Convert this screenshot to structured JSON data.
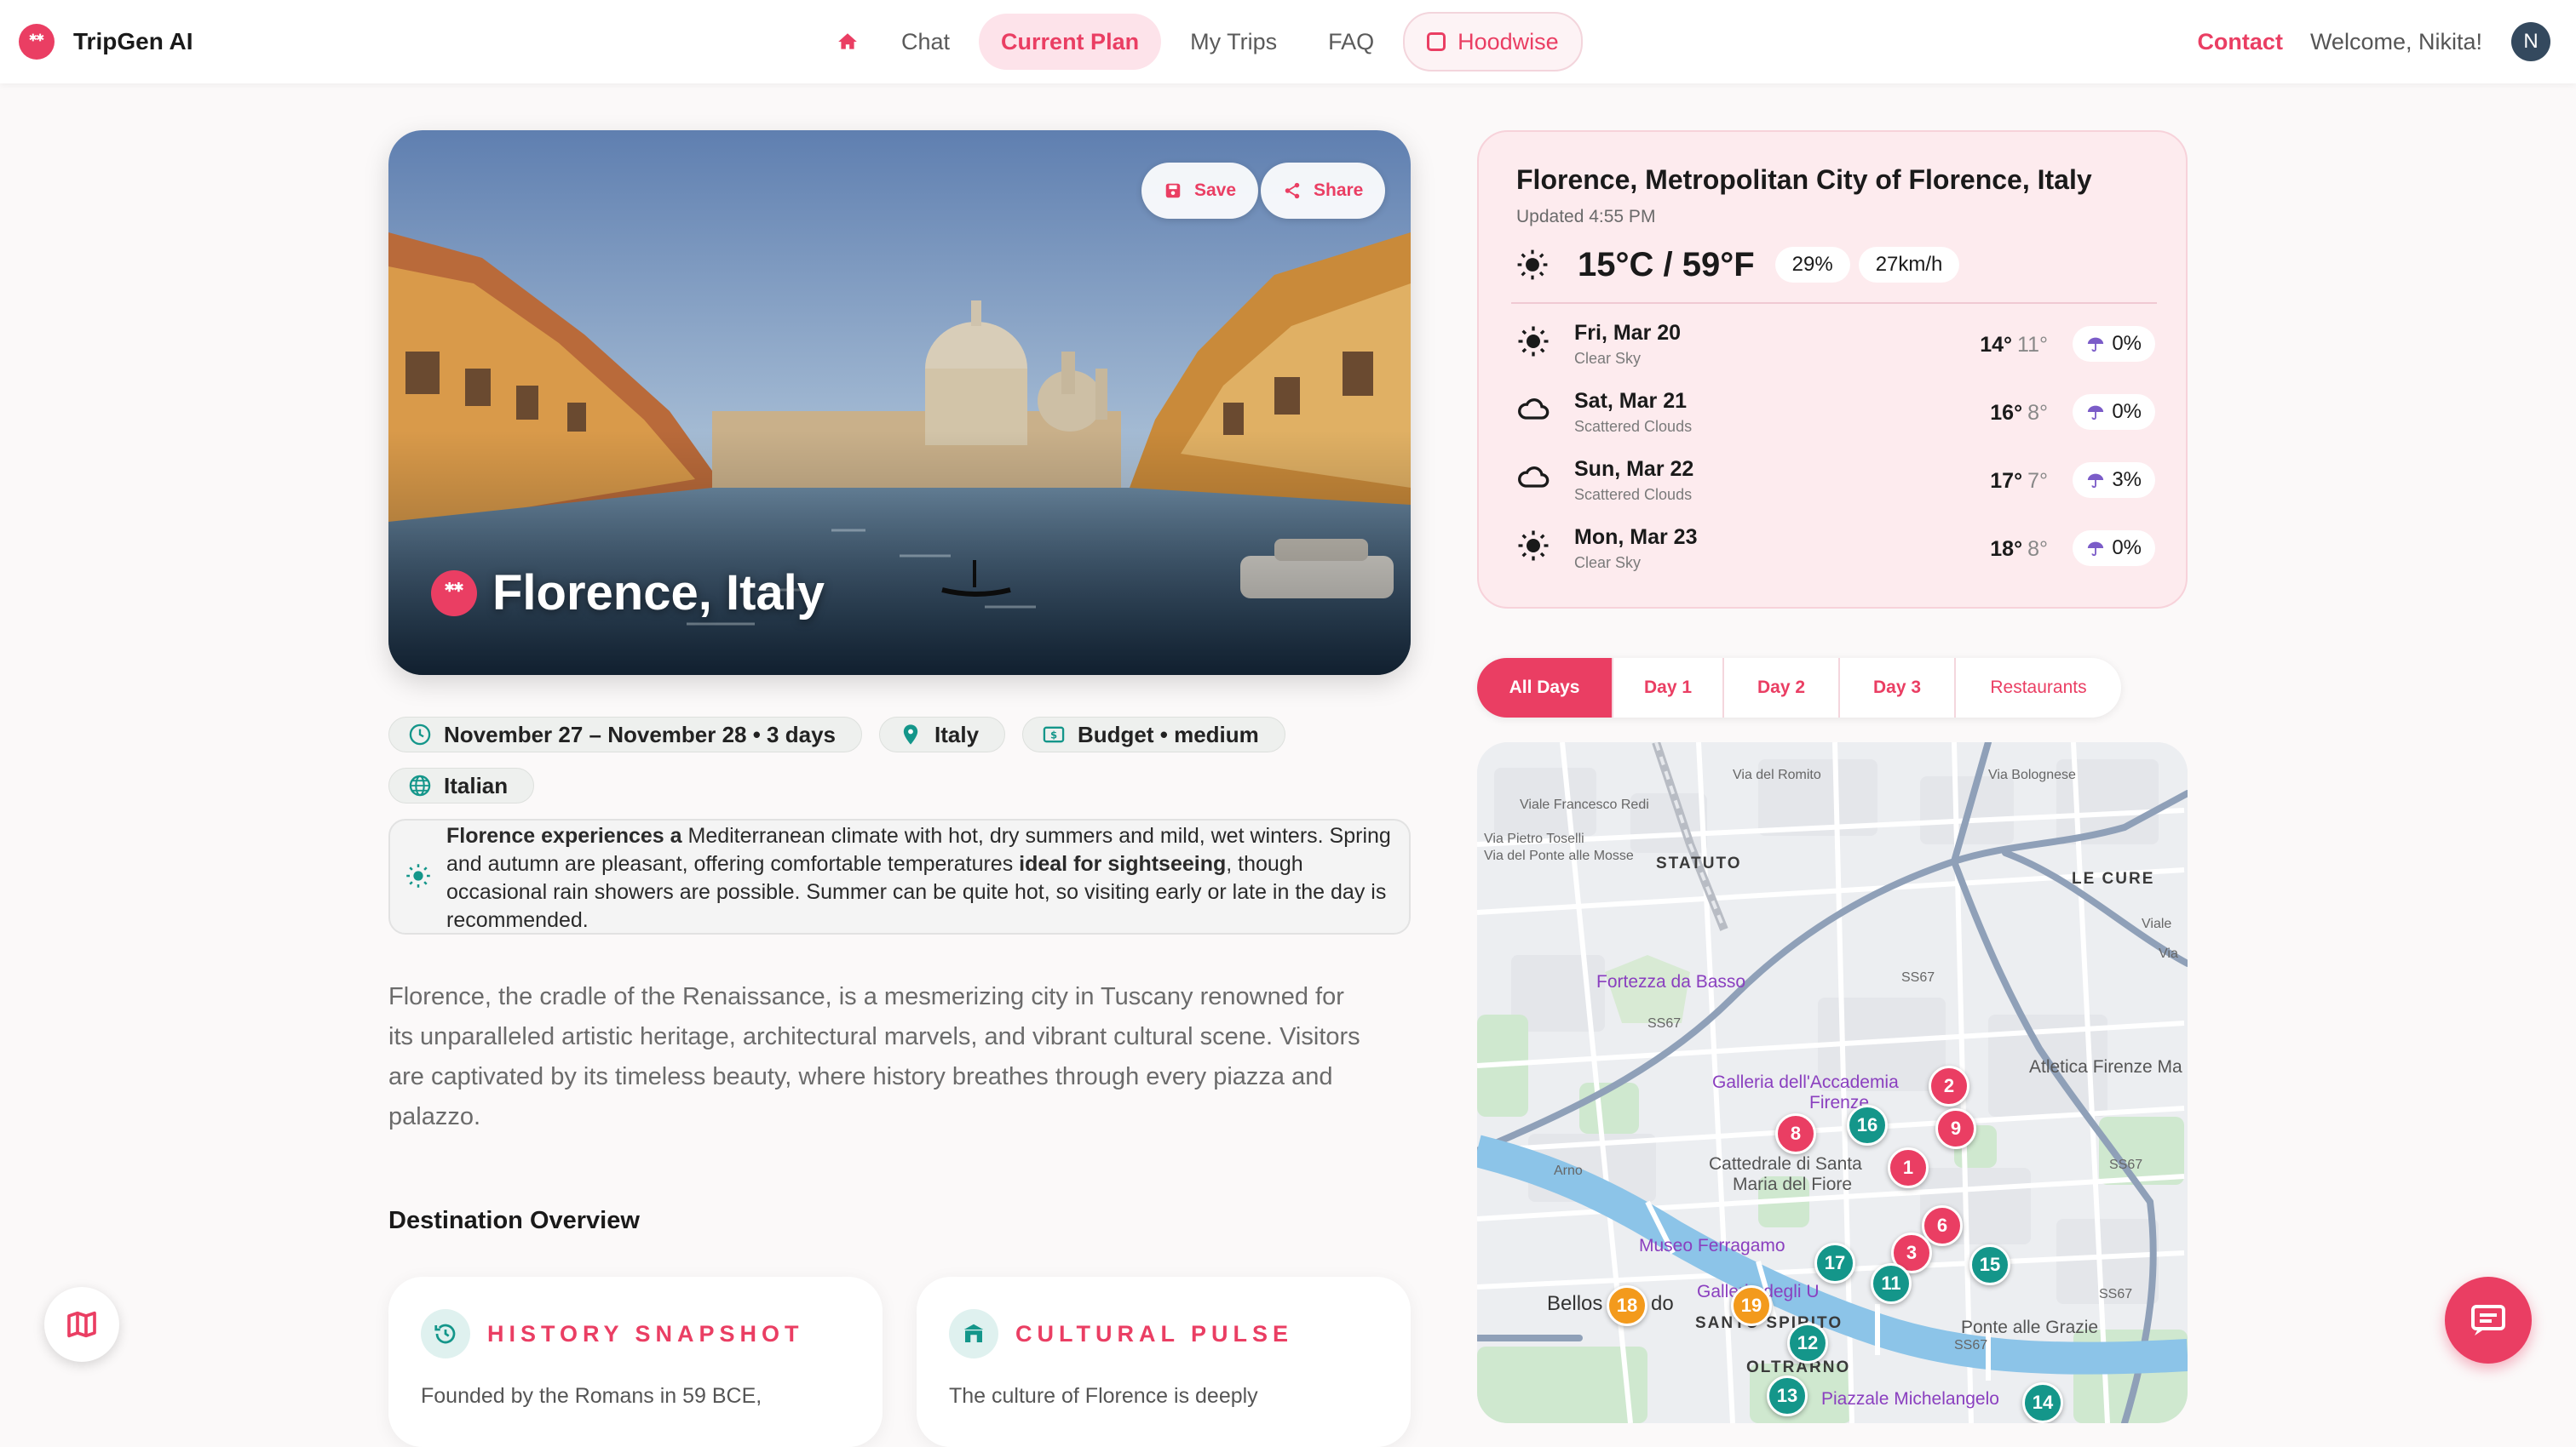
{
  "app": {
    "name": "TripGen AI"
  },
  "nav": {
    "items": [
      {
        "label": "Chat"
      },
      {
        "label": "Current Plan"
      },
      {
        "label": "My Trips"
      },
      {
        "label": "FAQ"
      },
      {
        "label": "Hoodwise"
      }
    ],
    "contact": "Contact",
    "welcome": "Welcome, Nikita!",
    "avatar_initial": "N"
  },
  "hero": {
    "title": "Florence, Italy",
    "save_label": "Save",
    "share_label": "Share"
  },
  "chips": {
    "dates": "November 27 – November 28 • 3 days",
    "country": "Italy",
    "budget": "Budget • medium",
    "language": "Italian"
  },
  "climate": {
    "bold_start": "Florence experiences a",
    "text1": " Mediterranean climate with hot, dry summers and mild, wet winters. Spring and autumn are pleasant, offering comfortable temperatures ",
    "bold_mid": "ideal for sightseeing",
    "text2": ", though occasional rain showers are possible. Summer can be quite hot, so visiting early or late in the day is recommended."
  },
  "intro": "Florence, the cradle of the Renaissance, is a mesmerizing city in Tuscany renowned for its unparalleled artistic heritage, architectural marvels, and vibrant cultural scene. Visitors are captivated by its timeless beauty, where history breathes through every piazza and palazzo.",
  "overview": {
    "title": "Destination Overview",
    "cards": [
      {
        "title": "HISTORY SNAPSHOT",
        "text": "Founded by the Romans in 59 BCE,"
      },
      {
        "title": "CULTURAL PULSE",
        "text": "The culture of Florence is deeply"
      }
    ]
  },
  "weather": {
    "location": "Florence, Metropolitan City of Florence, Italy",
    "updated": "Updated 4:55 PM",
    "current_temp": "15°C / 59°F",
    "humidity": "29%",
    "wind": "27km/h",
    "forecast": [
      {
        "day": "Fri, Mar 20",
        "desc": "Clear Sky",
        "high": "14°",
        "low": "11°",
        "rain": "0%",
        "icon": "sun-icon"
      },
      {
        "day": "Sat, Mar 21",
        "desc": "Scattered Clouds",
        "high": "16°",
        "low": "8°",
        "rain": "0%",
        "icon": "cloud-icon"
      },
      {
        "day": "Sun, Mar 22",
        "desc": "Scattered Clouds",
        "high": "17°",
        "low": "7°",
        "rain": "3%",
        "icon": "cloud-icon"
      },
      {
        "day": "Mon, Mar 23",
        "desc": "Clear Sky",
        "high": "18°",
        "low": "8°",
        "rain": "0%",
        "icon": "sun-icon"
      }
    ]
  },
  "tabs": [
    {
      "label": "All Days"
    },
    {
      "label": "Day 1"
    },
    {
      "label": "Day 2"
    },
    {
      "label": "Day 3"
    },
    {
      "label": "Restaurants"
    }
  ],
  "map": {
    "labels": {
      "statuto": "STATUTO",
      "le_cure": "LE CURE",
      "fortezza": "Fortezza da Basso",
      "galleria": "Galleria dell'Accademia",
      "firenze": "Firenze",
      "catt1": "Cattedrale di Santa",
      "catt2": "Maria del Fiore",
      "museo": "Museo Ferragamo",
      "galleria2": "Galleria degli U",
      "bellosguardo": "Bellos",
      "bellos_end": "do",
      "santo_spirito": "SANTO SPIRITO",
      "oltrarno": "OLTRARNO",
      "ponte": "Ponte alle Grazie",
      "atletica": "Atletica Firenze Ma",
      "piazzale": "Piazzale Michelangelo",
      "via_bolognese": "Via Bolognese",
      "via_romito": "Via del Romito",
      "via_redi": "Viale Francesco Redi",
      "via_toselli": "Via Pietro Toselli",
      "via_mosse": "Via del Ponte alle Mosse",
      "arno": "Arno",
      "viale": "Viale",
      "via": "Via",
      "ss67a": "SS67",
      "ss67b": "SS67",
      "ss67c": "SS67",
      "ss67d": "SS67",
      "ss67e": "SS67"
    },
    "pins": [
      {
        "n": "2",
        "color": "red"
      },
      {
        "n": "9",
        "color": "red"
      },
      {
        "n": "8",
        "color": "red"
      },
      {
        "n": "16",
        "color": "teal"
      },
      {
        "n": "1",
        "color": "red"
      },
      {
        "n": "6",
        "color": "red"
      },
      {
        "n": "3",
        "color": "red"
      },
      {
        "n": "17",
        "color": "teal"
      },
      {
        "n": "11",
        "color": "teal"
      },
      {
        "n": "15",
        "color": "teal"
      },
      {
        "n": "18",
        "color": "orange"
      },
      {
        "n": "19",
        "color": "orange"
      },
      {
        "n": "12",
        "color": "teal"
      },
      {
        "n": "13",
        "color": "teal"
      },
      {
        "n": "14",
        "color": "teal"
      }
    ]
  },
  "colors": {
    "accent": "#ea3e63",
    "teal": "#14968a",
    "orange": "#f39a1c"
  }
}
